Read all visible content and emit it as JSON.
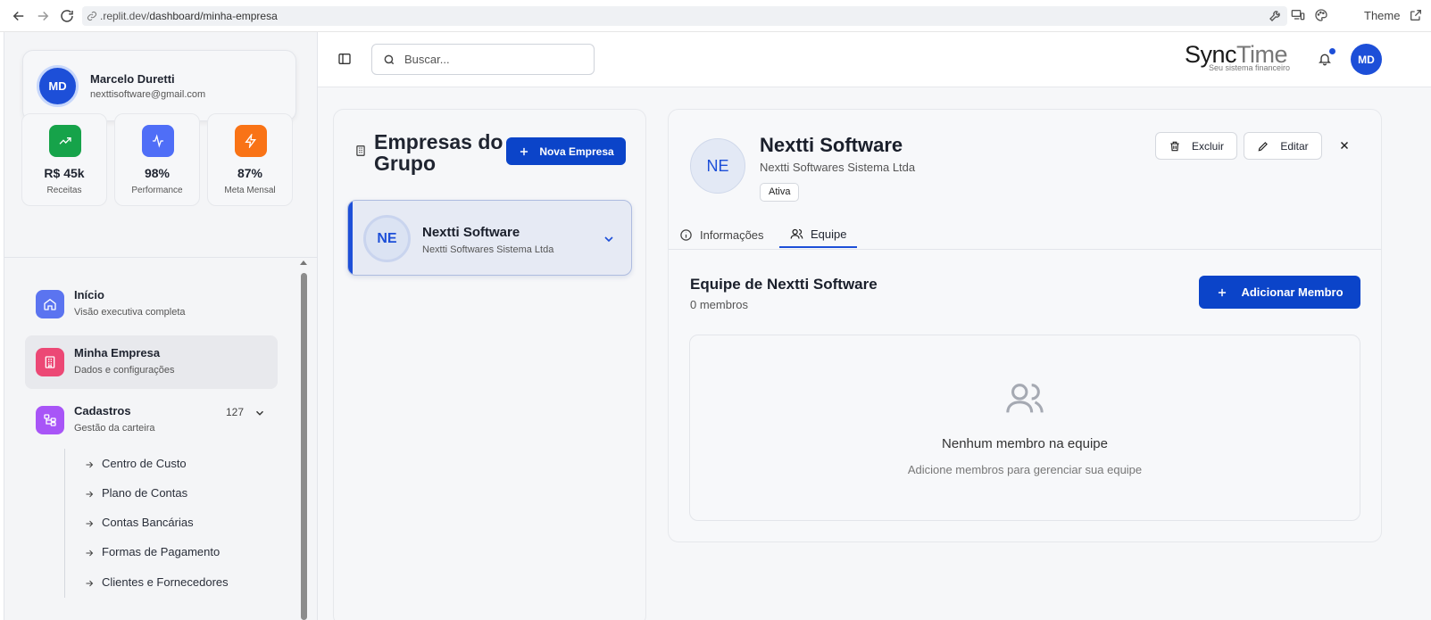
{
  "browser": {
    "url_prefix": ".replit.dev/",
    "url_path": "dashboard/minha-empresa",
    "theme_label": "Theme"
  },
  "user": {
    "initials": "MD",
    "name": "Marcelo Duretti",
    "email": "nexttisoftware@gmail.com"
  },
  "stats": [
    {
      "value": "R$ 45k",
      "label": "Receitas",
      "color": "#16a34a",
      "icon": "trending-up-icon"
    },
    {
      "value": "98%",
      "label": "Performance",
      "color": "#4f6ef7",
      "icon": "activity-icon"
    },
    {
      "value": "87%",
      "label": "Meta Mensal",
      "color": "#f97316",
      "icon": "zap-icon"
    }
  ],
  "sidebar": {
    "items": [
      {
        "title": "Início",
        "subtitle": "Visão executiva completa",
        "icon": "home-icon",
        "color": "#5b74f0"
      },
      {
        "title": "Minha Empresa",
        "subtitle": "Dados e configurações",
        "icon": "building-icon",
        "color": "#ec4875"
      },
      {
        "title": "Cadastros",
        "subtitle": "Gestão da carteira",
        "icon": "folder-tree-icon",
        "color": "#a855f7",
        "badge": "127"
      }
    ],
    "subitems": [
      "Centro de Custo",
      "Plano de Contas",
      "Contas Bancárias",
      "Formas de Pagamento",
      "Clientes e Fornecedores"
    ]
  },
  "topbar": {
    "search_placeholder": "Buscar...",
    "logo_part1": "Sync",
    "logo_part2": "Time",
    "logo_subtitle": "Seu sistema financeiro",
    "avatar_initials": "MD"
  },
  "companies_panel": {
    "title_line1": "Empresas do",
    "title_line2": "Grupo",
    "new_button": "Nova Empresa",
    "companies": [
      {
        "initials": "NE",
        "name": "Nextti Software",
        "legal_name": "Nextti Softwares Sistema Ltda"
      }
    ]
  },
  "detail": {
    "initials": "NE",
    "name": "Nextti Software",
    "legal_name": "Nextti Softwares Sistema Ltda",
    "status": "Ativa",
    "delete_button": "Excluir",
    "edit_button": "Editar",
    "tabs": [
      "Informações",
      "Equipe"
    ],
    "active_tab": "Equipe",
    "team_title": "Equipe de Nextti Software",
    "member_count": "0 membros",
    "add_member_button": "Adicionar Membro",
    "empty_title": "Nenhum membro na equipe",
    "empty_subtitle": "Adicione membros para gerenciar sua equipe"
  }
}
